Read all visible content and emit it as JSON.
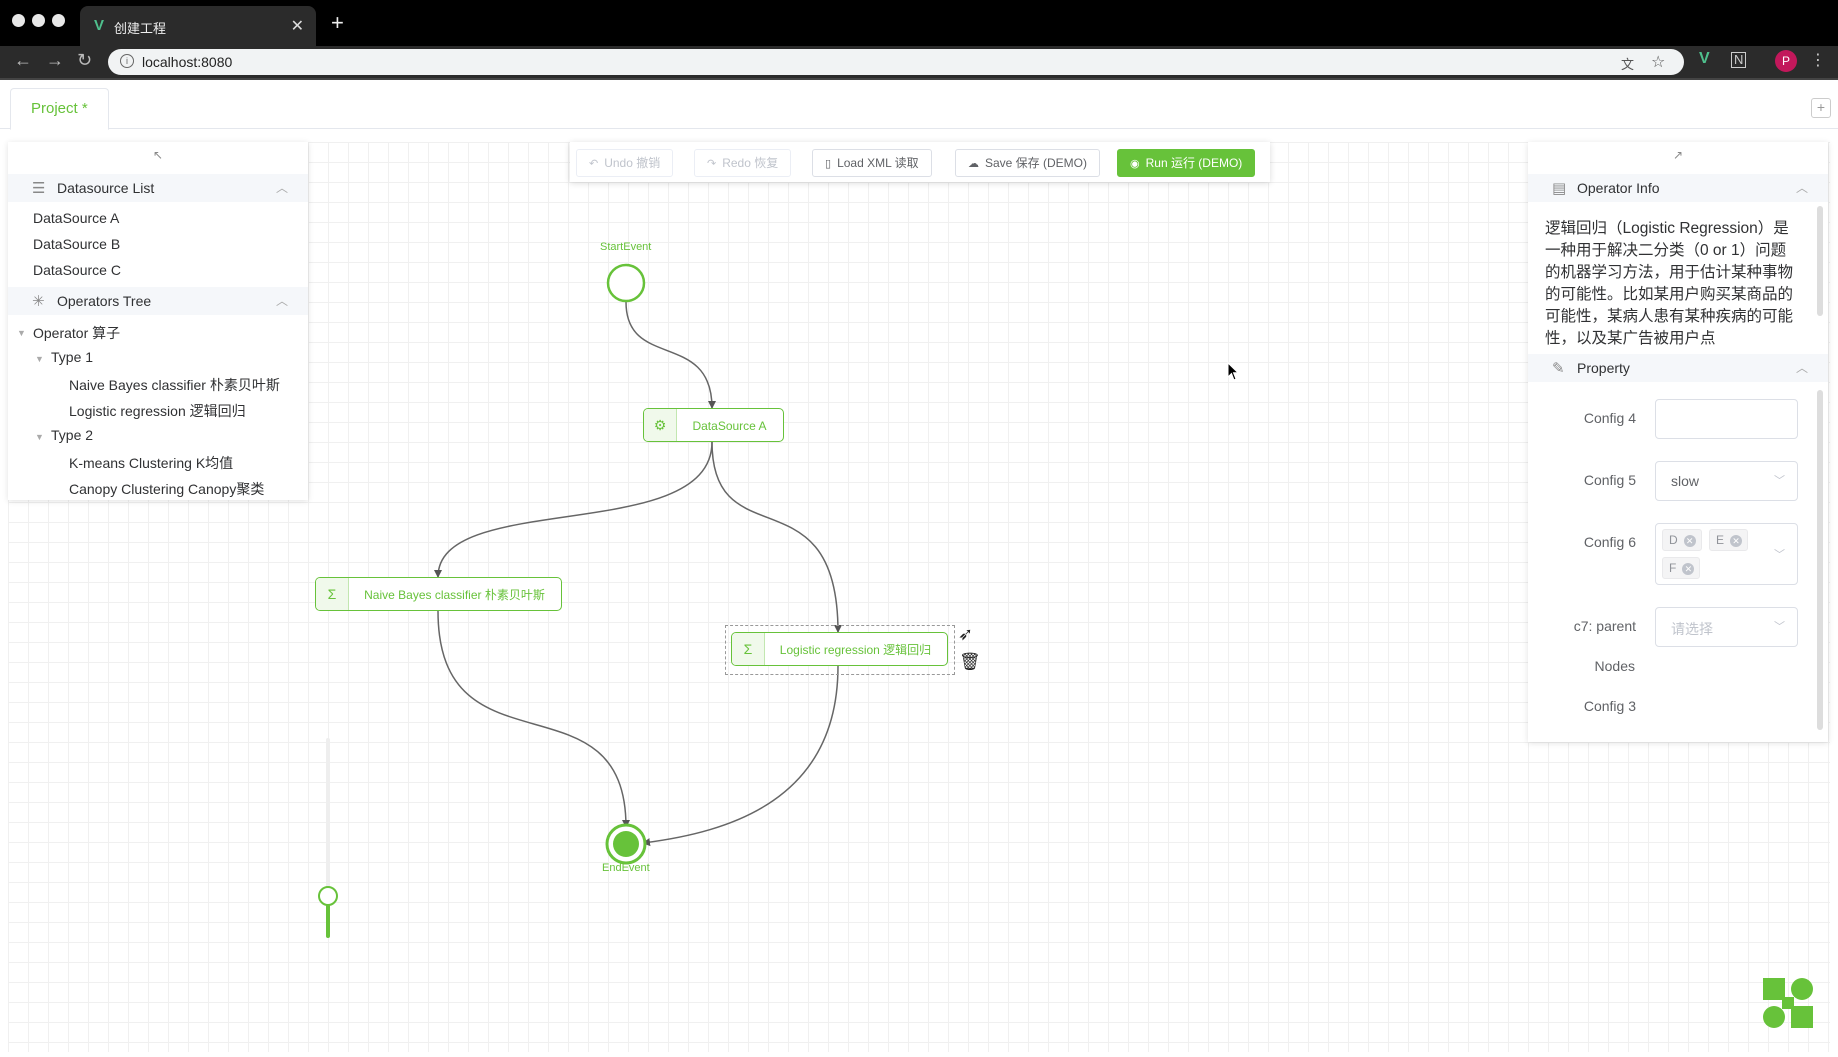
{
  "browser": {
    "tab_title": "创建工程",
    "tab_favicon": "vue-icon",
    "url": "localhost:8080",
    "profile_initial": "P"
  },
  "app_tabs": {
    "project_label": "Project *",
    "add_icon": "plus-square-icon"
  },
  "toolbar": {
    "undo_label": "Undo 撤销",
    "redo_label": "Redo 恢复",
    "load_label": "Load XML 读取",
    "save_label": "Save 保存 (DEMO)",
    "run_label": "Run 运行 (DEMO)"
  },
  "left_panel": {
    "datasource_title": "Datasource List",
    "datasources": [
      "DataSource A",
      "DataSource B",
      "DataSource C"
    ],
    "operators_title": "Operators Tree",
    "tree": {
      "root": "Operator 算子",
      "type1": "Type 1",
      "type1_items": [
        "Naive Bayes classifier 朴素贝叶斯",
        "Logistic regression 逻辑回归"
      ],
      "type2": "Type 2",
      "type2_items": [
        "K-means Clustering K均值",
        "Canopy Clustering Canopy聚类"
      ]
    }
  },
  "right_panel": {
    "info_title": "Operator Info",
    "info_text": "逻辑回归（Logistic Regression）是一种用于解决二分类（0 or 1）问题的机器学习方法，用于估计某种事物的可能性。比如某用户购买某商品的可能性，某病人患有某种疾病的可能性，以及某广告被用户点",
    "property_title": "Property",
    "config4_label": "Config 4",
    "config4_value": "",
    "config5_label": "Config 5",
    "config5_value": "slow",
    "config6_label": "Config 6",
    "config6_tags": [
      "D",
      "E",
      "F"
    ],
    "c7_label": "c7: parent",
    "c7_placeholder": "请选择",
    "nodes_label": "Nodes",
    "config3_label": "Config 3"
  },
  "graph": {
    "start_label": "StartEvent",
    "end_label": "EndEvent",
    "datasource_node": "DataSource A",
    "naive_node": "Naive Bayes classifier 朴素贝叶斯",
    "logistic_node": "Logistic regression 逻辑回归"
  },
  "colors": {
    "accent": "#67c23a",
    "edge": "#666666"
  }
}
